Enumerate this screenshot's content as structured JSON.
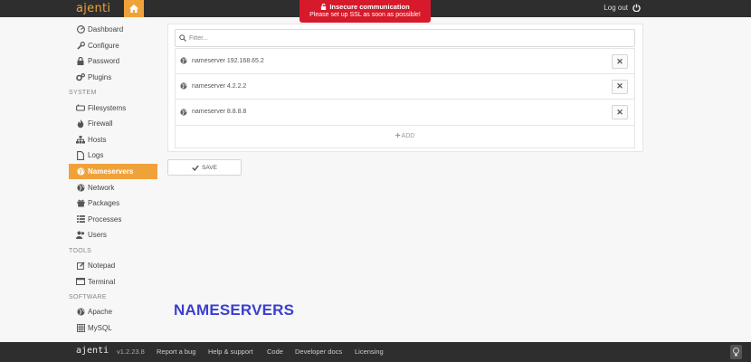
{
  "app": {
    "brand": "ajenti"
  },
  "topbar": {
    "logout_label": "Log out"
  },
  "alert": {
    "title": "Insecure communication",
    "message": "Please set up SSL as soon as possible!"
  },
  "sidebar": {
    "items_top": [
      {
        "label": "Dashboard",
        "icon": "dashboard-icon"
      },
      {
        "label": "Configure",
        "icon": "wrench-icon"
      },
      {
        "label": "Password",
        "icon": "lock-icon"
      },
      {
        "label": "Plugins",
        "icon": "gears-icon"
      }
    ],
    "section_system": "SYSTEM",
    "items_system": [
      {
        "label": "Filesystems",
        "icon": "hdd-icon"
      },
      {
        "label": "Firewall",
        "icon": "fire-icon"
      },
      {
        "label": "Hosts",
        "icon": "sitemap-icon"
      },
      {
        "label": "Logs",
        "icon": "file-icon"
      },
      {
        "label": "Nameservers",
        "icon": "globe-icon",
        "active": true
      },
      {
        "label": "Network",
        "icon": "globe-icon"
      },
      {
        "label": "Packages",
        "icon": "gift-icon"
      },
      {
        "label": "Processes",
        "icon": "list-icon"
      },
      {
        "label": "Users",
        "icon": "users-icon"
      }
    ],
    "section_tools": "TOOLS",
    "items_tools": [
      {
        "label": "Notepad",
        "icon": "edit-icon"
      },
      {
        "label": "Terminal",
        "icon": "terminal-icon"
      }
    ],
    "section_software": "SOFTWARE",
    "items_software": [
      {
        "label": "Apache",
        "icon": "globe-icon"
      },
      {
        "label": "MySQL",
        "icon": "table-icon"
      }
    ]
  },
  "filter": {
    "placeholder": "Filter..."
  },
  "nameservers": [
    {
      "label": "nameserver 192.168.65.2"
    },
    {
      "label": "nameserver 4.2.2.2"
    },
    {
      "label": "nameserver 8.8.8.8"
    }
  ],
  "add_label": "ADD",
  "save_label": "SAVE",
  "heading": "NAMESERVERS",
  "footer": {
    "brand": "ajenti",
    "version": "v1.2.23.8",
    "links": [
      "Report a bug",
      "Help & support",
      "Code",
      "Developer docs",
      "Licensing"
    ]
  },
  "colors": {
    "accent": "#f0a23a",
    "topbar": "#2e2e2e",
    "alert": "#d7192c",
    "heading": "#3b3fcf"
  }
}
